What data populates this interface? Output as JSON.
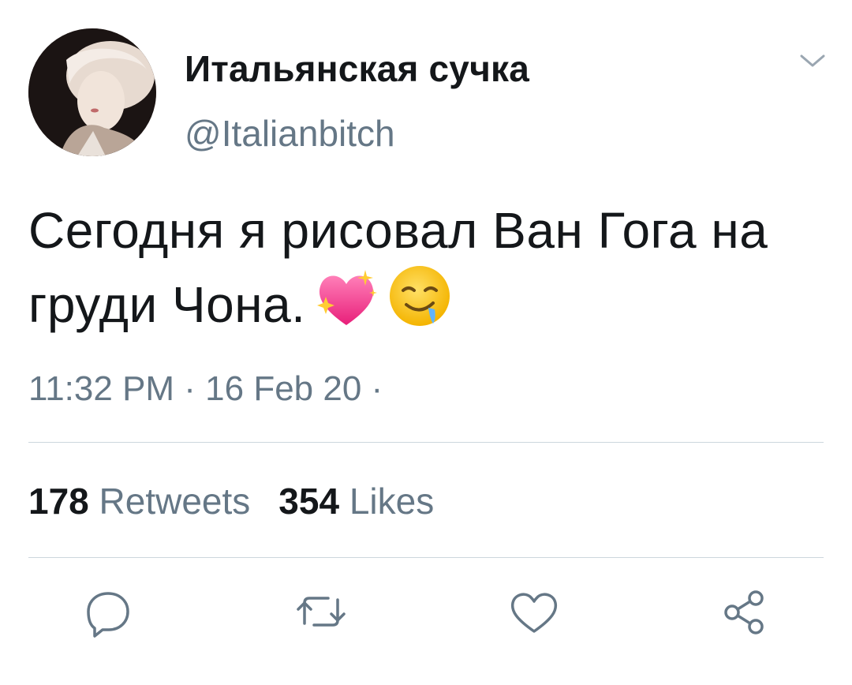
{
  "author": {
    "display_name": "Итальянская сучка",
    "handle": "@Italianbitch"
  },
  "tweet": {
    "text": "Сегодня я рисовал Ван Гога на груди Чона.",
    "emojis": [
      "sparkling-heart",
      "drooling-face"
    ],
    "timestamp": "11:32 PM · 16 Feb 20 ·"
  },
  "stats": {
    "retweets_count": "178",
    "retweets_label": "Retweets",
    "likes_count": "354",
    "likes_label": "Likes"
  },
  "icons": {
    "menu": "chevron-down-icon",
    "reply": "reply-icon",
    "retweet": "retweet-icon",
    "like": "heart-icon",
    "share": "share-icon"
  },
  "colors": {
    "text_primary": "#14171a",
    "text_secondary": "#657786",
    "divider": "#ccd6dd"
  }
}
